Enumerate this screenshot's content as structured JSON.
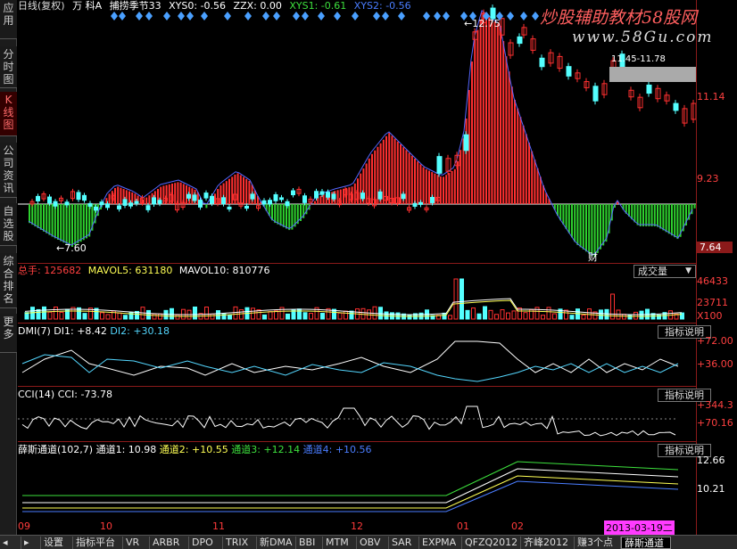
{
  "sidebar": {
    "items": [
      {
        "label": "应用",
        "active": false
      },
      {
        "label": "分时图",
        "active": false
      },
      {
        "label": "K线图",
        "active": true
      },
      {
        "label": "公司资讯",
        "active": false
      },
      {
        "label": "自选股",
        "active": false
      },
      {
        "label": "综合排名",
        "active": false
      },
      {
        "label": "更多",
        "active": false
      }
    ]
  },
  "header": {
    "period": "日线(复权)",
    "name": "万 科A",
    "indicator": "捕捞季节33",
    "xys0": "XYS0: -0.56",
    "zzx": "ZZX: 0.00",
    "xys1": "XYS1: -0.61",
    "xys2": "XYS2: -0.56"
  },
  "watermark": {
    "line1": "炒股辅助教材58股网",
    "line2": "www.58Gu.com"
  },
  "main_chart": {
    "price_max_label": "12.75",
    "price_min_label": "7.60",
    "range_label": "11.45-11.78",
    "marker": "财",
    "scale": [
      "11.14",
      "9.23",
      "7.64"
    ]
  },
  "volume": {
    "title_label": "总手:",
    "title_value": "125682",
    "mavol5": "MAVOL5: 631180",
    "mavol10": "MAVOL10: 810776",
    "dropdown": "成交量",
    "scale": [
      "46433",
      "23711",
      "X100"
    ]
  },
  "dmi": {
    "title": "DMI(7)",
    "di1": "DI1: +8.42",
    "di2": "DI2: +30.18",
    "button": "指标说明",
    "scale": [
      "+72.00",
      "+36.00"
    ]
  },
  "cci": {
    "title": "CCI(14)",
    "cci": "CCI: -73.78",
    "button": "指标说明",
    "scale": [
      "+344.3",
      "+70.16"
    ]
  },
  "xuesi": {
    "title": "薛斯通道(102,7)",
    "c1": "通道1: 10.98",
    "c2": "通道2: +10.55",
    "c3": "通道3: +12.14",
    "c4": "通道4: +10.56",
    "button": "指标说明",
    "scale": [
      "12.66",
      "10.21"
    ]
  },
  "xaxis": {
    "labels": [
      "09",
      "10",
      "11",
      "12",
      "01",
      "02"
    ],
    "date": "2013-03-19二"
  },
  "tabs": [
    "设置",
    "指标平台",
    "VR",
    "ARBR",
    "DPO",
    "TRIX",
    "新DMA",
    "BBI",
    "MTM",
    "OBV",
    "SAR",
    "EXPMA",
    "QFZQ2012",
    "齐峰2012",
    "赚3个点",
    "薛斯通道"
  ],
  "active_tab": "薛斯通道",
  "colors": {
    "up": "#ff3030",
    "down": "#54ffff",
    "green_hist": "#2ed12e",
    "border": "#8b1a1a",
    "diamond": "#4aa0ff"
  }
}
